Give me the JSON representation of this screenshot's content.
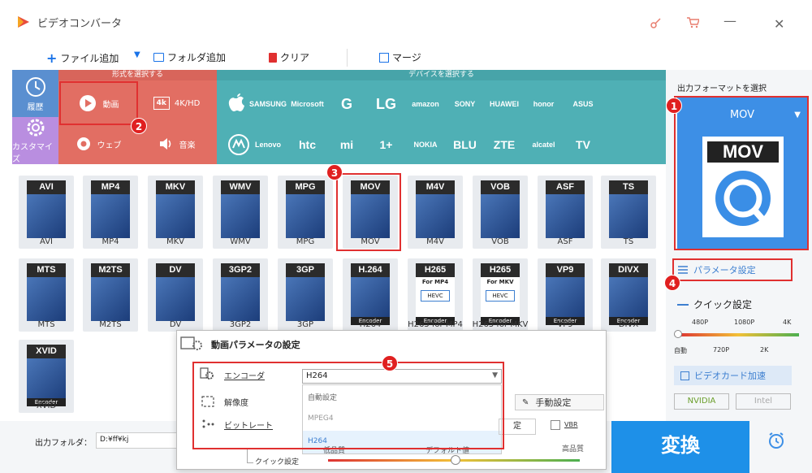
{
  "app": {
    "title": "ビデオコンバータ"
  },
  "toolbar": {
    "add_file": "ファイル追加",
    "add_folder": "フォルダ追加",
    "clear": "クリア",
    "merge": "マージ"
  },
  "category": {
    "format_header": "形式を選択する",
    "device_header": "デバイスを選択する",
    "history": "履歴",
    "customize": "カスタマイズ",
    "video": "動画",
    "hd": "4K/HD",
    "web": "ウェブ",
    "audio": "音楽"
  },
  "brands_row1": [
    "SAMSUNG",
    "Microsoft",
    "G",
    "LG",
    "amazon",
    "SONY",
    "HUAWEI",
    "honor",
    "ASUS"
  ],
  "brands_row2": [
    "Lenovo",
    "htc",
    "mi",
    "1+",
    "NOKIA",
    "BLU",
    "ZTE",
    "alcatel",
    "TV"
  ],
  "formats": [
    {
      "top": "AVI",
      "name": "AVI"
    },
    {
      "top": "MP4",
      "name": "MP4"
    },
    {
      "top": "MKV",
      "name": "MKV"
    },
    {
      "top": "WMV",
      "name": "WMV"
    },
    {
      "top": "MPG",
      "name": "MPG"
    },
    {
      "top": "MOV",
      "name": "MOV"
    },
    {
      "top": "M4V",
      "name": "M4V"
    },
    {
      "top": "VOB",
      "name": "VOB"
    },
    {
      "top": "ASF",
      "name": "ASF"
    },
    {
      "top": "TS",
      "name": "TS"
    },
    {
      "top": "MTS",
      "name": "MTS"
    },
    {
      "top": "M2TS",
      "name": "M2TS"
    },
    {
      "top": "DV",
      "name": "DV"
    },
    {
      "top": "3GP2",
      "name": "3GP2"
    },
    {
      "top": "3GP",
      "name": "3GP"
    },
    {
      "top": "H.264",
      "name": "H264",
      "sub": "Encoder"
    },
    {
      "top": "H265",
      "name": "H265 for MP4",
      "sub": "Encoder",
      "sub2": "For MP4",
      "sub3": "HEVC"
    },
    {
      "top": "H265",
      "name": "H265 for MKV",
      "sub": "Encoder",
      "sub2": "For MKV",
      "sub3": "HEVC"
    },
    {
      "top": "VP9",
      "name": "VP9",
      "sub": "Encoder"
    },
    {
      "top": "DIVX",
      "name": "DIVX",
      "sub": "Encoder"
    },
    {
      "top": "XVID",
      "name": "XVID",
      "sub": "Encoder"
    }
  ],
  "right": {
    "select_format": "出力フォーマットを選択",
    "current_format": "MOV",
    "preview_label": "MOV",
    "param_settings": "パラメータ設定",
    "quick_settings": "クイック設定",
    "quality_top": [
      "480P",
      "1080P",
      "4K"
    ],
    "quality_bottom": [
      "自動",
      "720P",
      "2K"
    ],
    "gpu_accel": "ビデオカード加速",
    "nvidia": "NVIDIA",
    "intel": "Intel"
  },
  "bottom": {
    "output_folder_label": "出力フォルダ：",
    "output_folder_value": "D:¥ff¥kj",
    "convert": "変換"
  },
  "popup": {
    "title": "動画パラメータの設定",
    "encoder_label": "エンコーダ",
    "encoder_value": "H264",
    "resolution_label": "解像度",
    "bitrate_label": "ビットレート",
    "options": [
      "自動設定",
      "MPEG4",
      "H264"
    ],
    "manual_settings": "手動設定",
    "settings_partial": "定",
    "vbr": "VBR",
    "quick_label": "クイック設定",
    "low_quality": "低品質",
    "default_value": "デフォルト値",
    "high_quality": "高品質"
  },
  "badges": [
    "1",
    "2",
    "3",
    "4",
    "5"
  ],
  "colors": {
    "red_cat": "#e26e63",
    "teal": "#4fb0b5",
    "blue_cat": "#5a8fd0",
    "purple_cat": "#b98ee0",
    "convert_blue": "#1e90e8",
    "highlight": "#e03030"
  }
}
